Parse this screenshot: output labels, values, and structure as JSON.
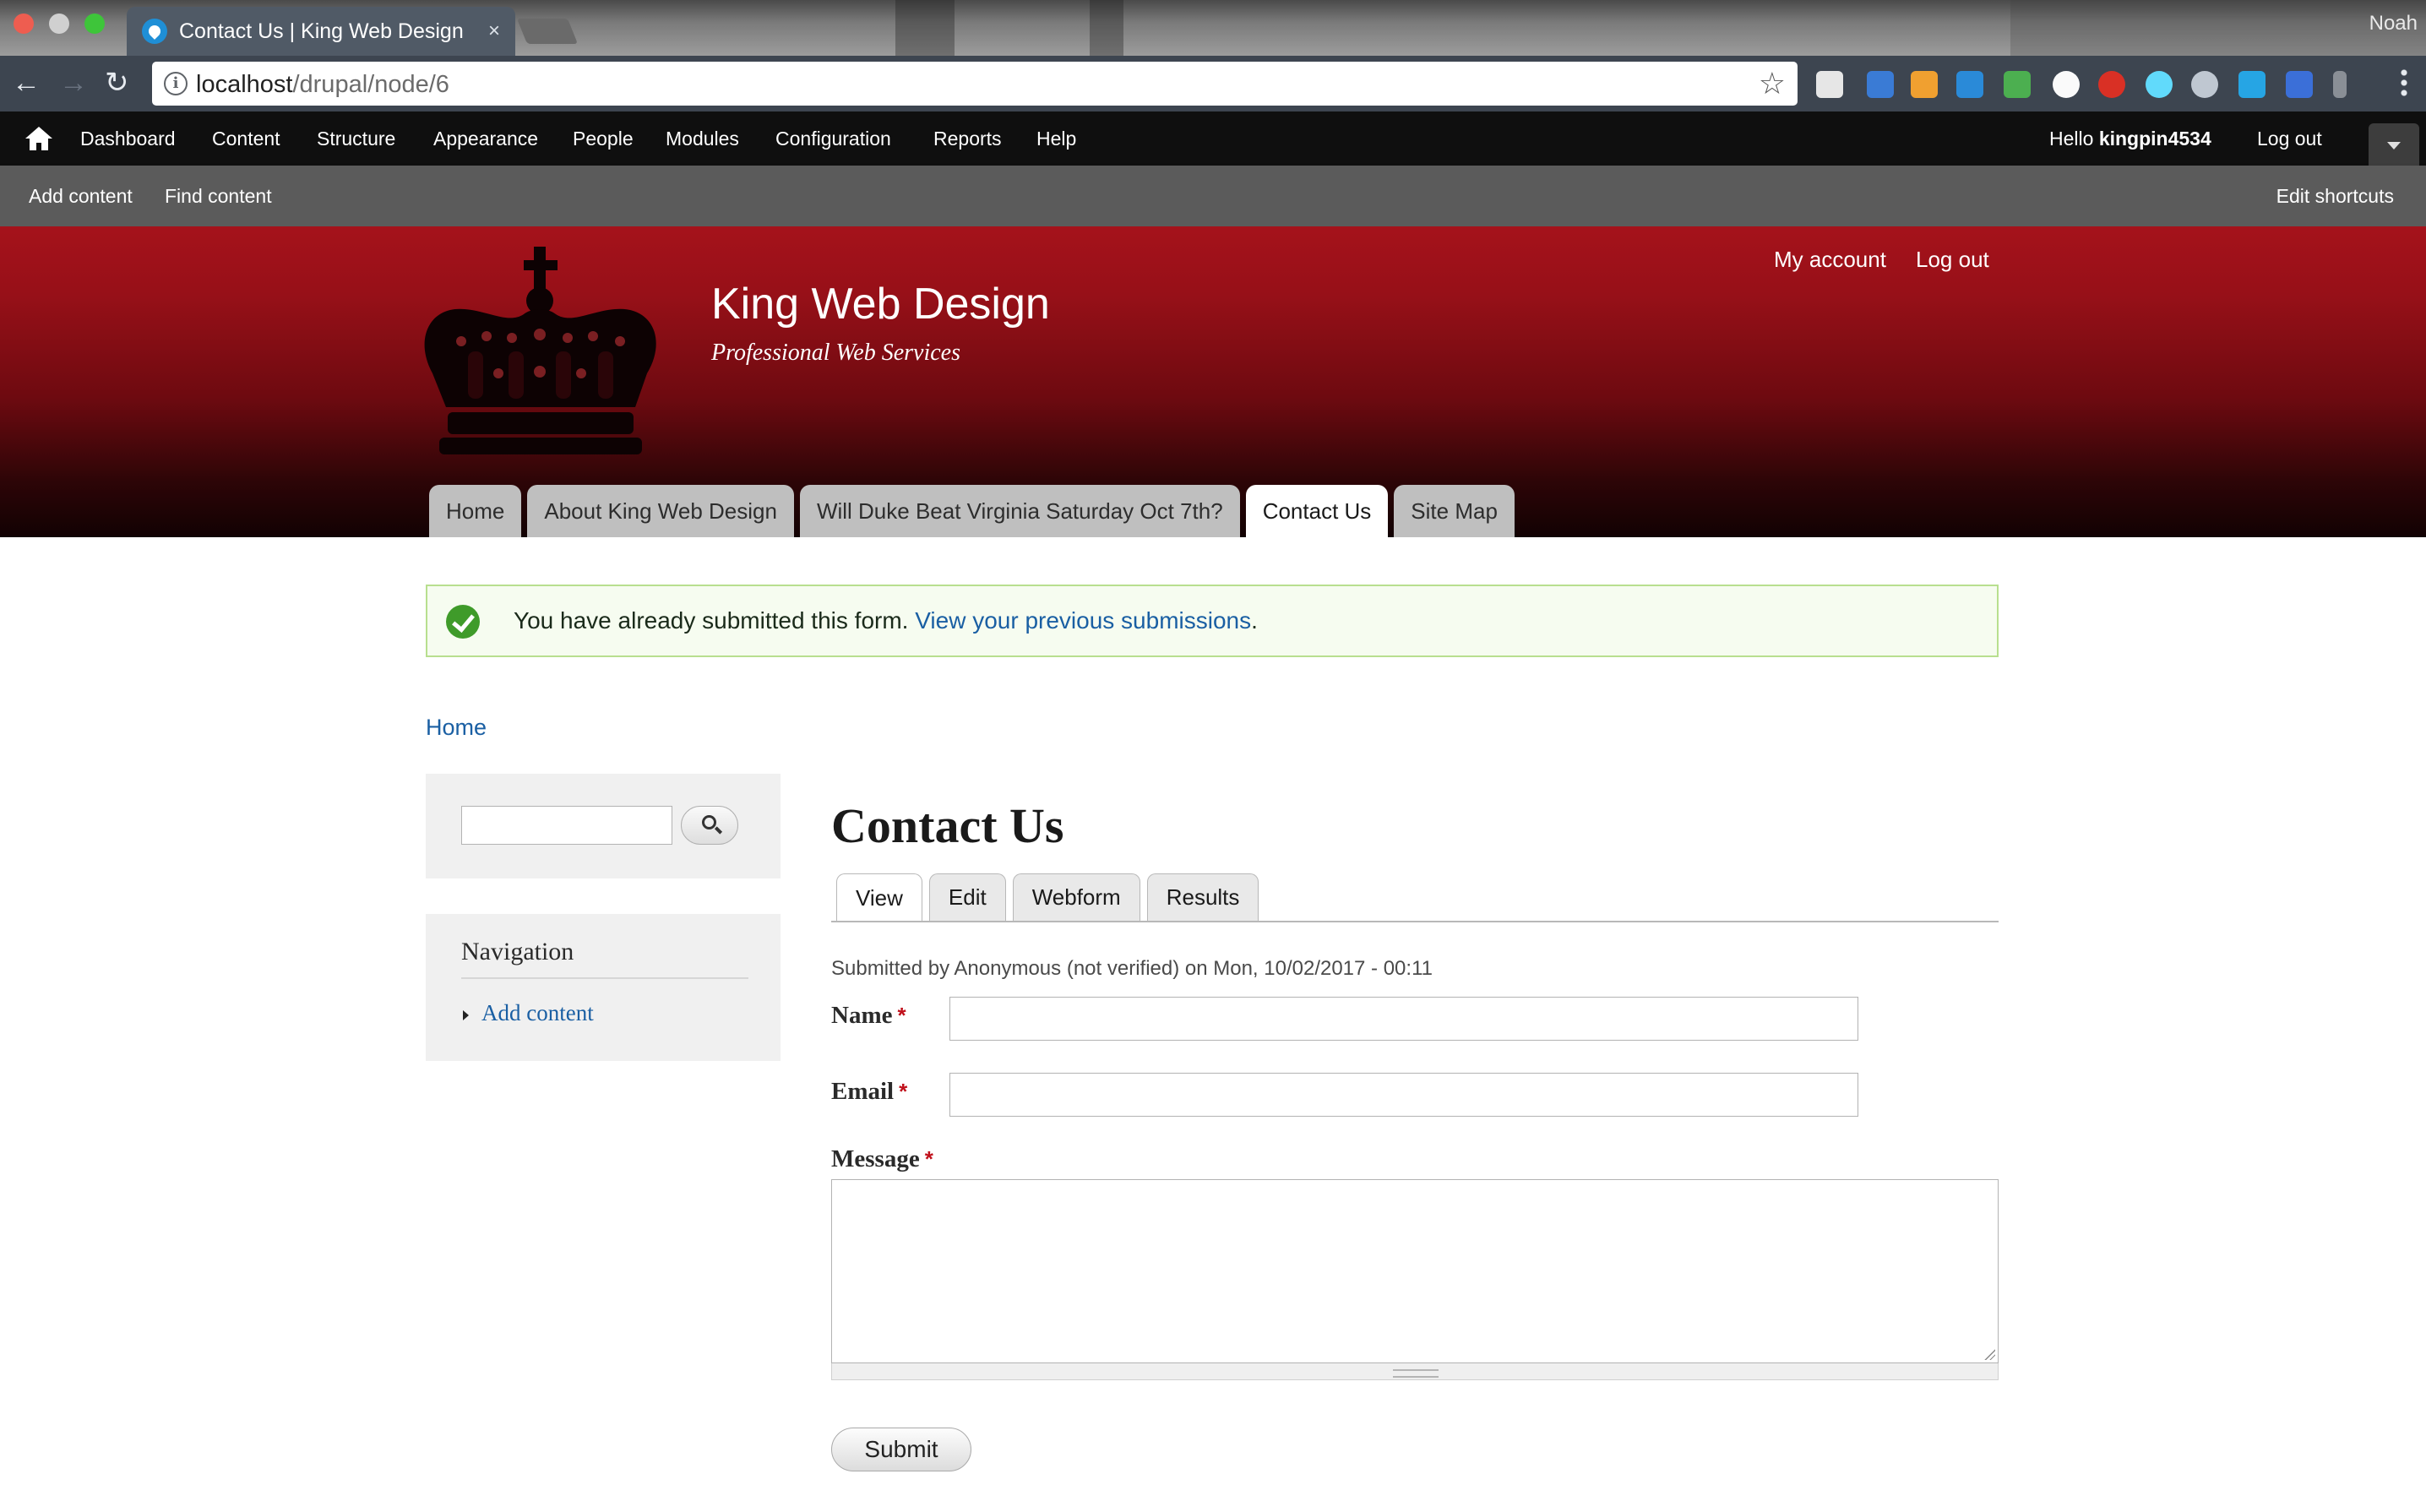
{
  "browser": {
    "tab_title": "Contact Us | King Web Design",
    "tab_close": "×",
    "url_host": "localhost",
    "url_path": "/drupal/node/6",
    "profile_name": "Noah",
    "back_icon": "←",
    "forward_icon": "→",
    "reload_icon": "↻",
    "star_icon": "☆",
    "traffic_colors": [
      "#ee5d50",
      "#d0d0d0",
      "#3ec53a"
    ]
  },
  "admin_toolbar": {
    "items": [
      "Dashboard",
      "Content",
      "Structure",
      "Appearance",
      "People",
      "Modules",
      "Configuration",
      "Reports",
      "Help"
    ],
    "hello_prefix": "Hello ",
    "username": "kingpin4534",
    "logout": "Log out"
  },
  "shortcuts": {
    "items": [
      "Add content",
      "Find content"
    ],
    "edit": "Edit shortcuts"
  },
  "site": {
    "name": "King Web Design",
    "slogan": "Professional Web Services",
    "secondary_links": [
      "My account",
      "Log out"
    ],
    "primary_tabs": [
      "Home",
      "About King Web Design",
      "Will Duke Beat Virginia Saturday Oct 7th?",
      "Contact Us",
      "Site Map"
    ],
    "active_tab": "Contact Us",
    "header_color": "#a5121b"
  },
  "status": {
    "text": "You have already submitted this form.",
    "link": "View your previous submissions",
    "suffix": "."
  },
  "breadcrumb": "Home",
  "sidebar": {
    "search_value": "",
    "nav_title": "Navigation",
    "nav_links": [
      "Add content"
    ]
  },
  "page": {
    "title": "Contact Us",
    "tabs": [
      "View",
      "Edit",
      "Webform",
      "Results"
    ],
    "active_tab": "View",
    "submitted": "Submitted by Anonymous (not verified) on Mon, 10/02/2017 - 00:11"
  },
  "form": {
    "name_label": "Name",
    "email_label": "Email",
    "message_label": "Message",
    "required_mark": "*",
    "name_value": "",
    "email_value": "",
    "message_value": "",
    "submit": "Submit"
  }
}
